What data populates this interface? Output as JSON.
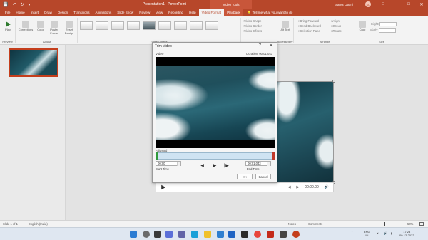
{
  "titlebar": {
    "doc_title": "Presentation1 - PowerPoint",
    "context": "Video Tools",
    "user": "Satya Laxmi"
  },
  "tabs": [
    "File",
    "Home",
    "Insert",
    "Draw",
    "Design",
    "Transitions",
    "Animations",
    "Slide Show",
    "Review",
    "View",
    "Recording",
    "Help",
    "Video Format",
    "Playback"
  ],
  "active_tab": "Playback",
  "tell_me": "Tell me what you want to do",
  "ribbon": {
    "play": "Play",
    "corrections": "Corrections",
    "color": "Color",
    "poster_frame": "Poster Frame",
    "reset_design": "Reset Design",
    "video_shape": "Video Shape",
    "video_border": "Video Border",
    "video_effects": "Video Effects",
    "alt_text": "Alt Text",
    "bring_forward": "Bring Forward",
    "send_backward": "Send Backward",
    "selection_pane": "Selection Pane",
    "align": "Align",
    "group": "Group",
    "rotate": "Rotate",
    "crop": "Crop",
    "height_label": "Height:",
    "width_label": "Width:",
    "group_preview": "Preview",
    "group_adjust": "Adjust",
    "group_styles": "Video Styles",
    "group_access": "Accessibility",
    "group_arrange": "Arrange",
    "group_size": "Size"
  },
  "slide": {
    "number": "1"
  },
  "dialog": {
    "title": "Trim Video",
    "help": "?",
    "close": "✕",
    "video_label": "Video",
    "duration": "Duration: 00:01.043",
    "adjusted_label": "Adjusted",
    "start_time_value": "00:00",
    "start_time_label": "Start Time",
    "end_time_value": "00:01.043",
    "end_time_label": "End Time",
    "ok": "OK",
    "cancel": "Cancel"
  },
  "video_controls": {
    "time": "00:00.00"
  },
  "statusbar": {
    "slide_of": "Slide 1 of 1",
    "language": "English (India)",
    "notes": "Notes",
    "comments": "Comments",
    "zoom": "50%"
  },
  "taskbar": {
    "language": "ENG",
    "region": "IN",
    "time": "17:28",
    "date": "09-12-2022"
  }
}
